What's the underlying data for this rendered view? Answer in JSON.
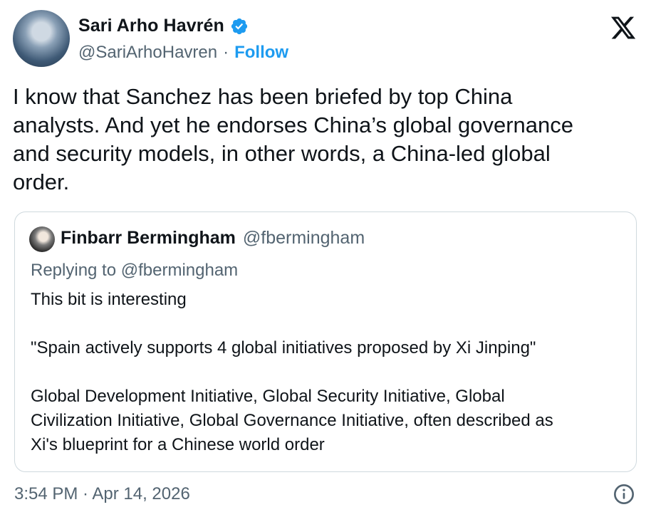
{
  "author": {
    "name": "Sari Arho Havrén",
    "handle": "@SariArhoHavren",
    "separator": "·",
    "follow_label": "Follow"
  },
  "tweet": {
    "text": "I know that Sanchez has been briefed by top China\nanalysts. And yet he endorses China’s global governance\nand security models, in other words, a China-led global\norder."
  },
  "quoted": {
    "name": "Finbarr Bermingham",
    "handle": "@fbermingham",
    "replying_to": "Replying to @fbermingham",
    "text": "This bit is interesting\n\n\"Spain actively supports 4 global initiatives proposed by Xi Jinping\"\n\nGlobal Development Initiative, Global Security Initiative, Global\nCivilization Initiative, Global Governance Initiative, often described as\nXi's blueprint for a Chinese world order"
  },
  "footer": {
    "timestamp": "3:54 PM · Apr 14, 2026"
  },
  "icons": {
    "verified": "verified-badge-icon",
    "platform": "x-logo-icon",
    "info": "info-icon"
  },
  "colors": {
    "accent": "#1d9bf0",
    "text": "#0f1419",
    "muted": "#536471",
    "border": "#cfd9de"
  }
}
